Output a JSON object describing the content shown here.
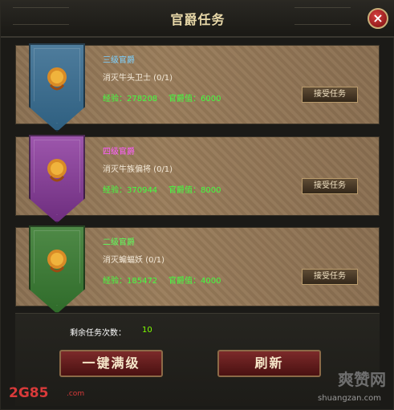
{
  "window": {
    "title": "官爵任务",
    "close_icon": "×"
  },
  "quests": [
    {
      "title": "三级官爵",
      "task": "消灭牛头卫士 (0/1)",
      "exp": "经验：278208",
      "rank": "官爵值：6000",
      "button": "接受任务"
    },
    {
      "title": "四级官爵",
      "task": "消灭牛族偏将 (0/1)",
      "exp": "经验：370944",
      "rank": "官爵值：8000",
      "button": "接受任务"
    },
    {
      "title": "二级官爵",
      "task": "消灭蝙蝠妖 (0/1)",
      "exp": "经验：185472",
      "rank": "官爵值：4000",
      "button": "接受任务"
    }
  ],
  "footer": {
    "remaining_label": "剩余任务次数：",
    "remaining_value": "10",
    "btn_level": "一键满级",
    "btn_refresh": "刷新"
  },
  "watermark": {
    "left_logo": "2G85",
    "left_suffix": ".com",
    "right_logo": "爽赞网",
    "right_url": "shuangzan.com"
  }
}
